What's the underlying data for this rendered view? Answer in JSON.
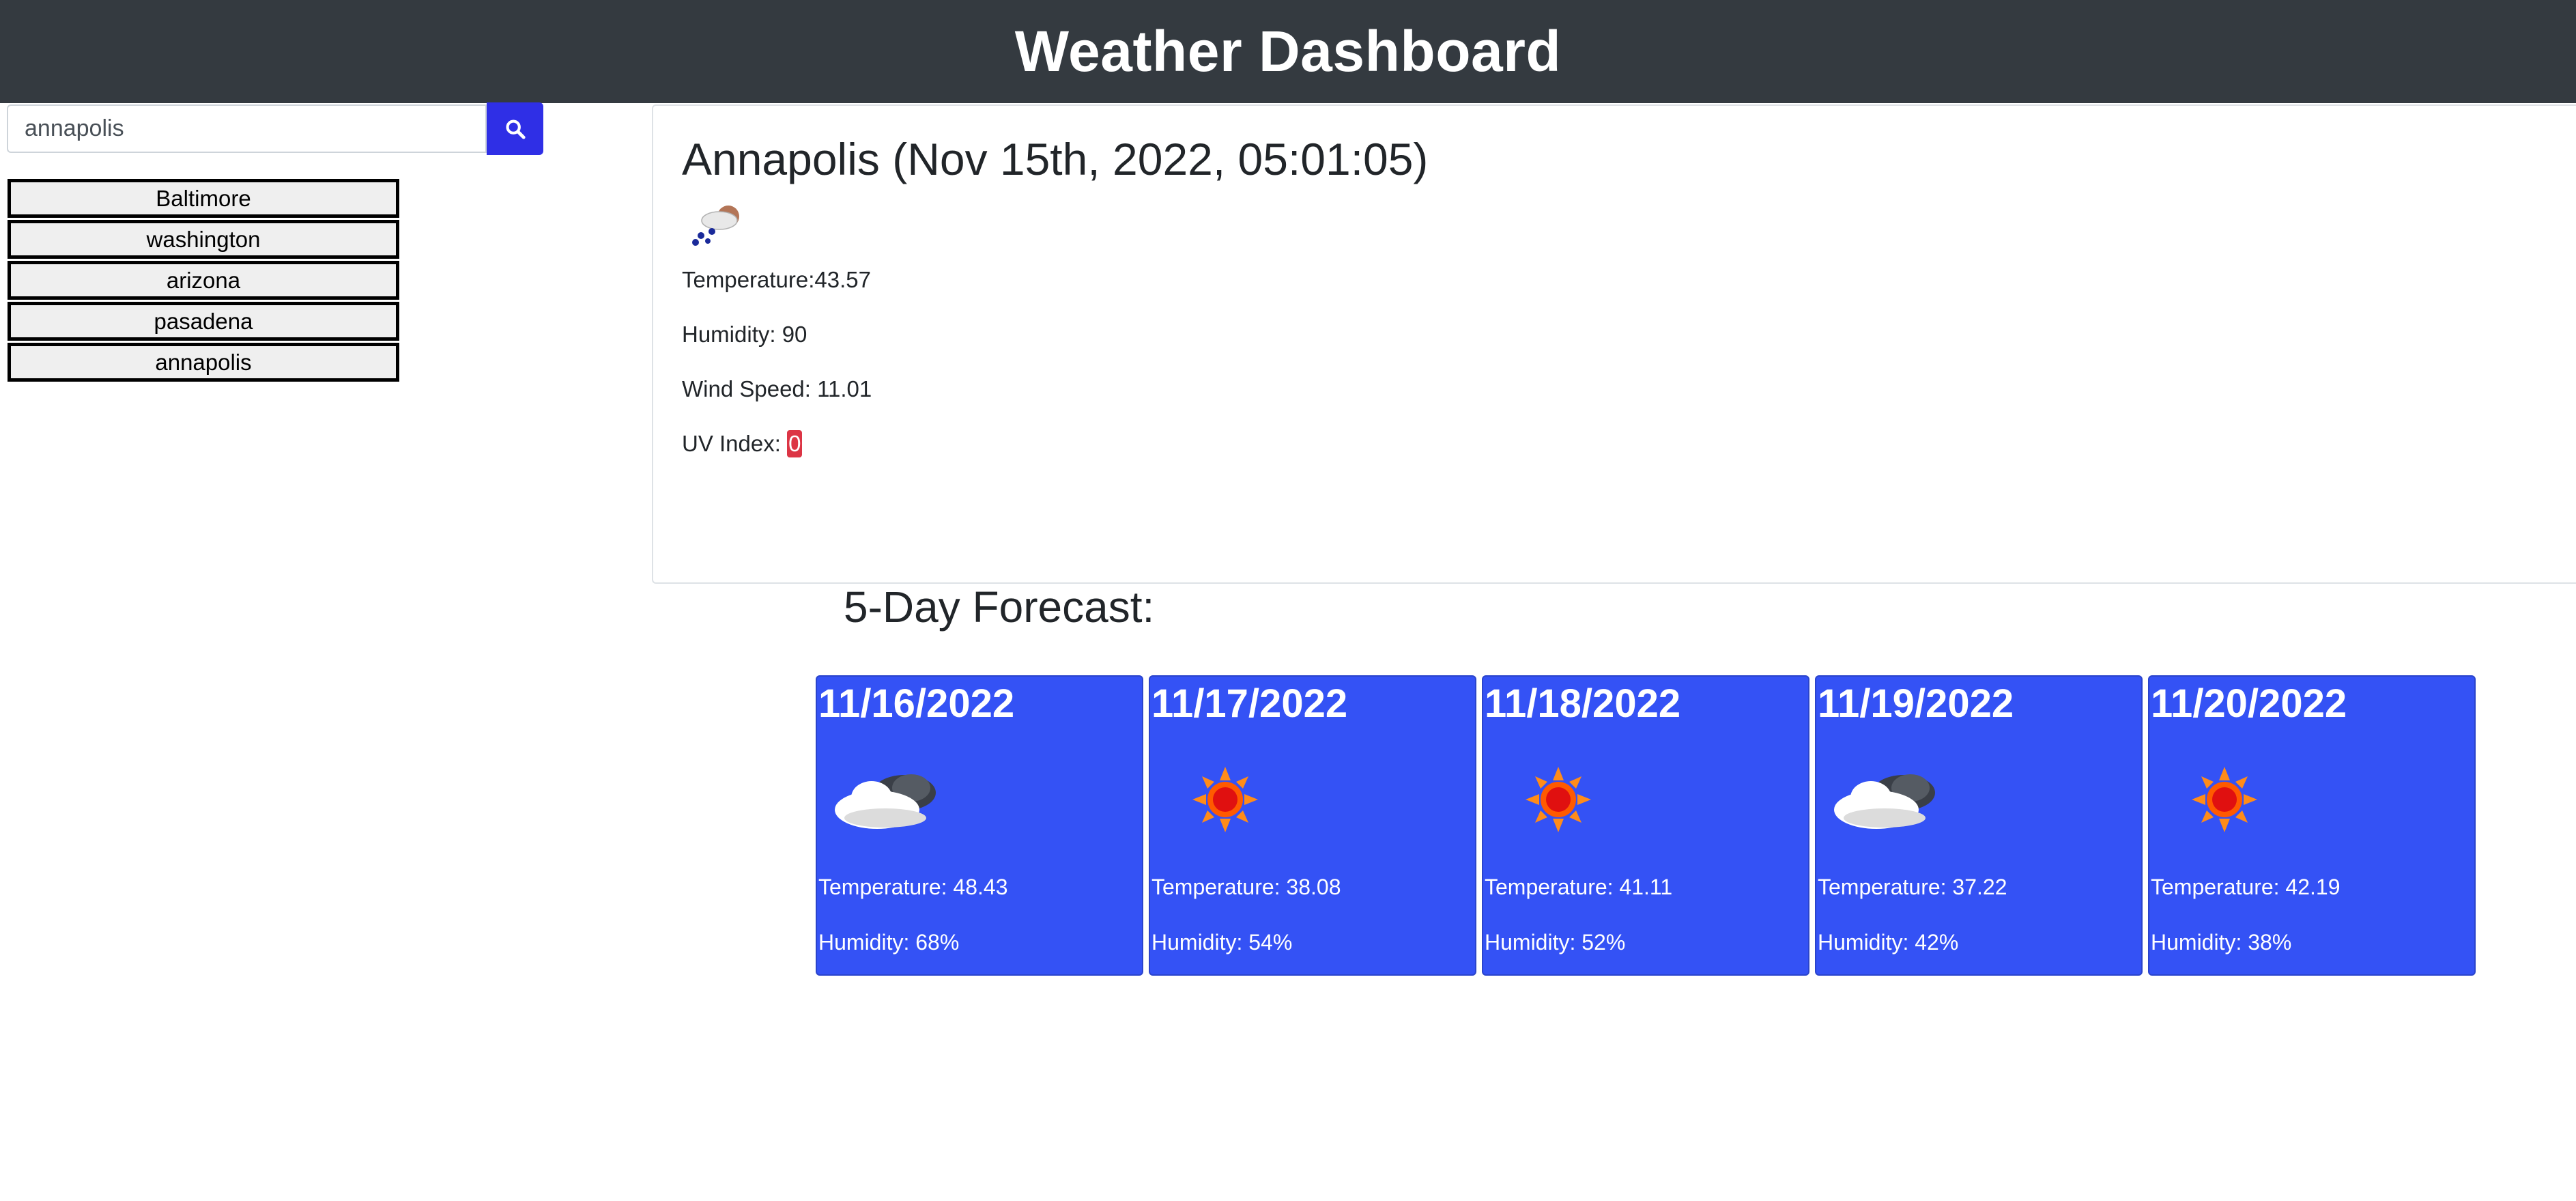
{
  "header": {
    "title": "Weather Dashboard"
  },
  "search": {
    "value": "annapolis",
    "icon": "search-icon"
  },
  "history": [
    "Baltimore",
    "washington",
    "arizona",
    "pasadena",
    "annapolis"
  ],
  "current": {
    "title": "Annapolis (Nov 15th, 2022, 05:01:05)",
    "icon": "rain-night-icon",
    "temperature": "Temperature:43.57",
    "humidity": "Humidity: 90",
    "wind": "Wind Speed: 11.01",
    "uv_label": "UV Index: ",
    "uv_value": "0"
  },
  "forecast_title": "5-Day Forecast:",
  "forecast": [
    {
      "date": "11/16/2022",
      "icon": "cloudy-icon",
      "temp": "Temperature: 48.43",
      "humidity": "Humidity: 68%"
    },
    {
      "date": "11/17/2022",
      "icon": "sun-icon",
      "temp": "Temperature: 38.08",
      "humidity": "Humidity: 54%"
    },
    {
      "date": "11/18/2022",
      "icon": "sun-icon",
      "temp": "Temperature: 41.11",
      "humidity": "Humidity: 52%"
    },
    {
      "date": "11/19/2022",
      "icon": "cloudy-icon",
      "temp": "Temperature: 37.22",
      "humidity": "Humidity: 42%"
    },
    {
      "date": "11/20/2022",
      "icon": "sun-icon",
      "temp": "Temperature: 42.19",
      "humidity": "Humidity: 38%"
    }
  ],
  "colors": {
    "header_bg": "#343a40",
    "search_button": "#2f2fe6",
    "forecast_card": "#3452f5",
    "uv_badge": "#dc3545"
  }
}
